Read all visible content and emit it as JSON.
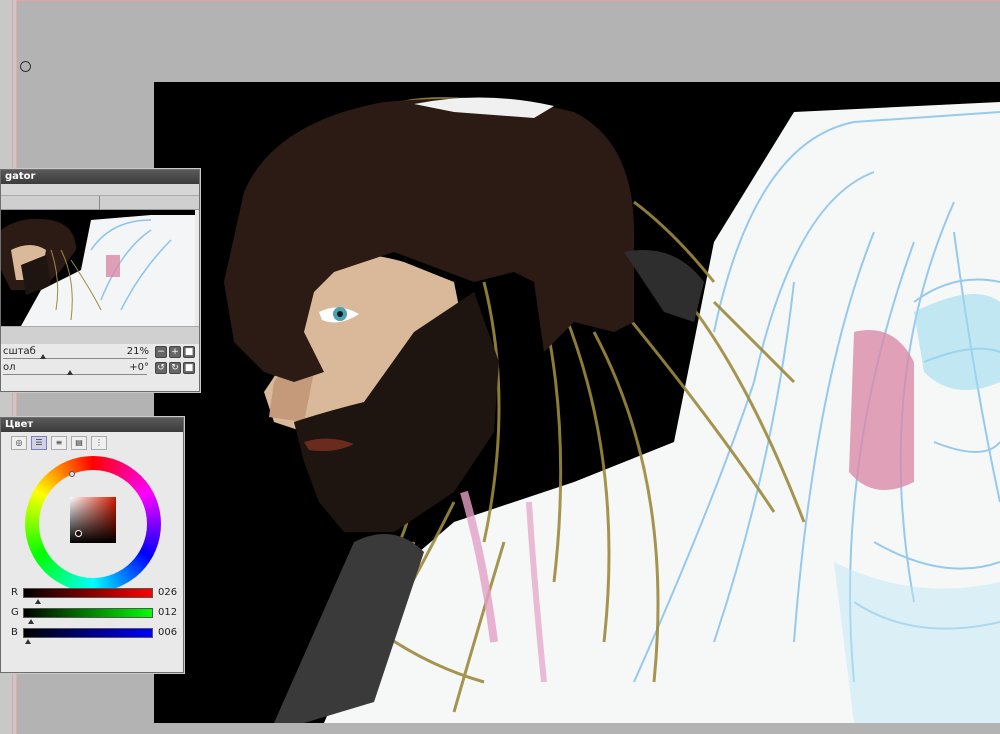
{
  "navigator": {
    "title": "gator",
    "zoom_label": "сштаб",
    "zoom_value": "21%",
    "rotate_label": "ол",
    "rotate_value": "+0°",
    "zoom_buttons": [
      "−",
      "+",
      "■"
    ],
    "rotate_buttons": [
      "↺",
      "↻",
      "■"
    ]
  },
  "color": {
    "title": "Цвет",
    "tabs": [
      "wheel-tab",
      "slider-tab",
      "palette-tab",
      "sets-tab",
      "history-tab"
    ],
    "active_tab": 1,
    "current_color": "#1a0c06",
    "channels": [
      {
        "label": "R",
        "value": "026",
        "color": "#ff0000"
      },
      {
        "label": "G",
        "value": "012",
        "color": "#00ff00"
      },
      {
        "label": "B",
        "value": "006",
        "color": "#0000ff"
      }
    ]
  },
  "canvas": {
    "description_icon": "painting-canvas",
    "background": "#000000"
  }
}
